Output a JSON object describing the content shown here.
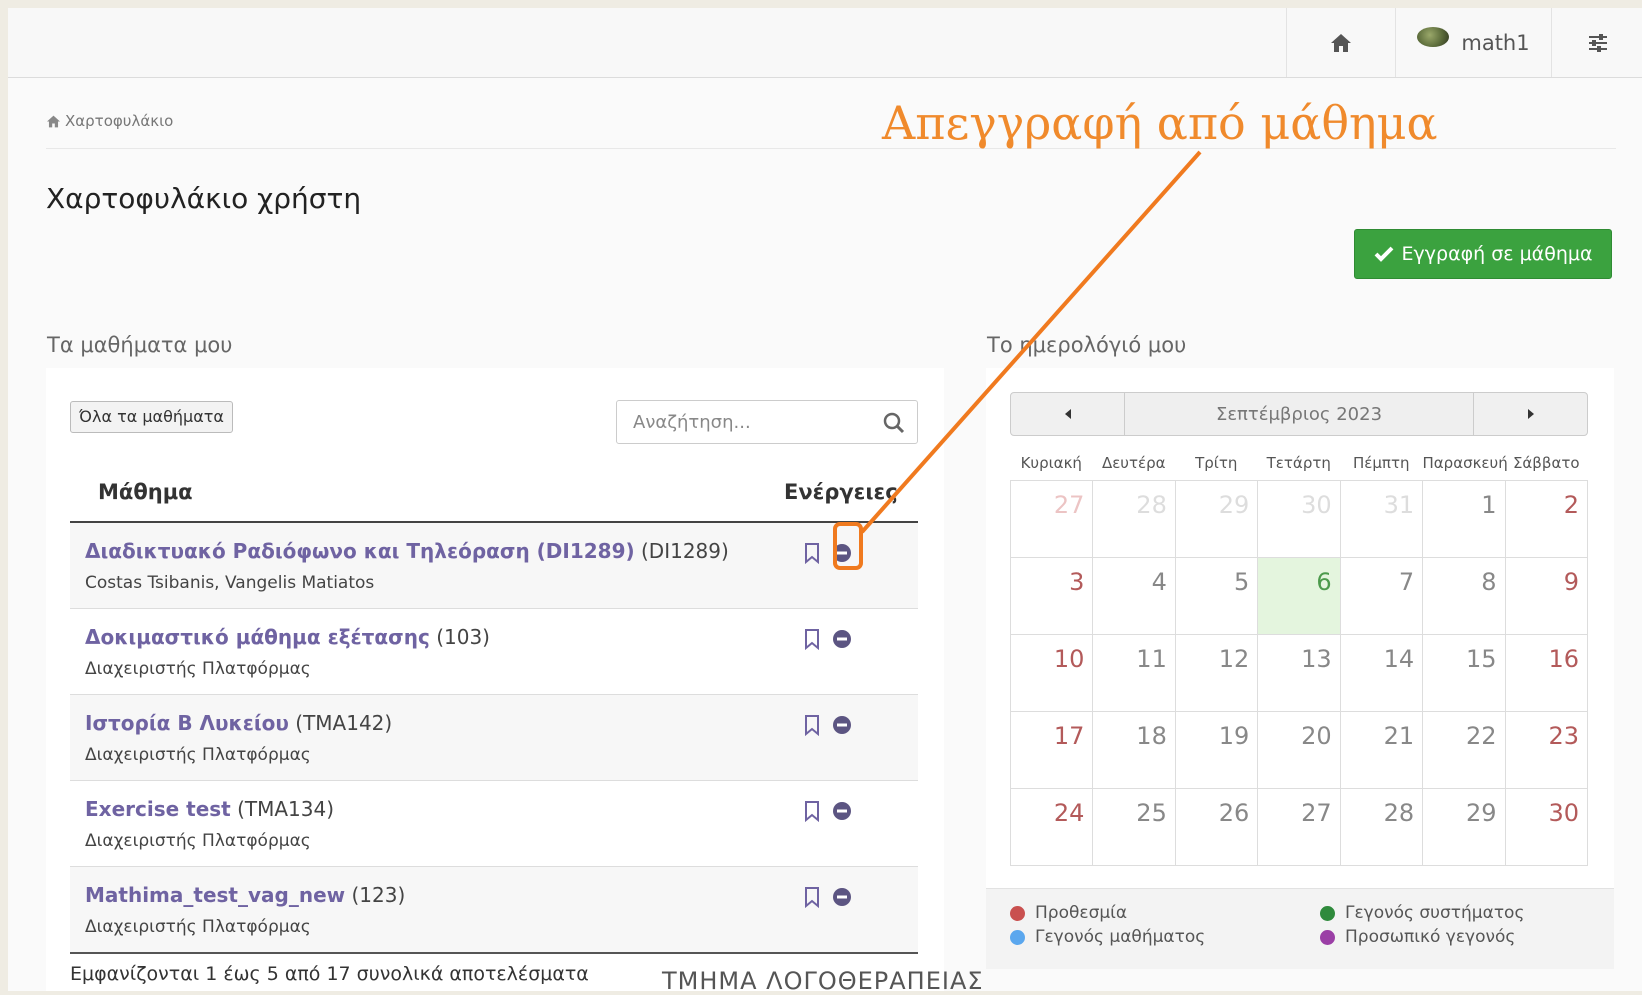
{
  "navbar": {
    "username": "math1",
    "home_icon": "home-icon",
    "settings_icon": "sliders-icon"
  },
  "breadcrumb": {
    "label": "Χαρτοφυλάκιο"
  },
  "page": {
    "title": "Χαρτοφυλάκιο χρήστη",
    "register_button": "Εγγραφή σε μάθημα"
  },
  "courses": {
    "heading": "Τα μαθήματα μου",
    "all_courses_button": "Όλα τα μαθήματα",
    "search_placeholder": "Αναζήτηση...",
    "col_course": "Μάθημα",
    "col_actions": "Ενέργειες",
    "rows": [
      {
        "title": "Διαδικτυακό Ραδιόφωνο και Τηλεόραση (DI1289)",
        "code": "(DI1289)",
        "instructors": "Costas Tsibanis, Vangelis Matiatos"
      },
      {
        "title": "Δοκιμαστικό μάθημα εξέτασης",
        "code": "(103)",
        "instructors": "Διαχειριστής Πλατφόρμας"
      },
      {
        "title": "Ιστορία Β Λυκείου",
        "code": "(TMA142)",
        "instructors": "Διαχειριστής Πλατφόρμας"
      },
      {
        "title": "Exercise test",
        "code": "(TMA134)",
        "instructors": "Διαχειριστής Πλατφόρμας"
      },
      {
        "title": "Mathima_test_vag_new",
        "code": "(123)",
        "instructors": "Διαχειριστής Πλατφόρμας"
      }
    ],
    "results_text": "Εμφανίζονται 1 έως 5 από 17 συνολικά αποτελέσματα"
  },
  "calendar": {
    "heading": "Το ημερολόγιό μου",
    "month": "Σεπτέμβριος 2023",
    "weekdays": [
      "Κυριακή",
      "Δευτέρα",
      "Τρίτη",
      "Τετάρτη",
      "Πέμπτη",
      "Παρασκευή",
      "Σάββατο"
    ],
    "weeks": [
      [
        "27",
        "28",
        "29",
        "30",
        "31",
        "1",
        "2"
      ],
      [
        "3",
        "4",
        "5",
        "6",
        "7",
        "8",
        "9"
      ],
      [
        "10",
        "11",
        "12",
        "13",
        "14",
        "15",
        "16"
      ],
      [
        "17",
        "18",
        "19",
        "20",
        "21",
        "22",
        "23"
      ],
      [
        "24",
        "25",
        "26",
        "27",
        "28",
        "29",
        "30"
      ]
    ],
    "other_month_count_leading": 5,
    "today": "6",
    "legend": [
      {
        "label": "Προθεσμία",
        "color": "#c9504f"
      },
      {
        "label": "Γεγονός μαθήματος",
        "color": "#5ba7ee"
      },
      {
        "label": "Γεγονός συστήματος",
        "color": "#2f8a3c"
      },
      {
        "label": "Προσωπικό γεγονός",
        "color": "#9b3fa6"
      }
    ]
  },
  "annotation": {
    "text": "Απεγγραφή από μάθημα",
    "color": "#f08a2c"
  },
  "footer_text": "ΤΜΗΜΑ ΛΟΓΟΘΕΡΑΠΕΙΑΣ",
  "colors": {
    "accent_green": "#3ba23f",
    "course_link": "#6f63a2",
    "weekend": "#b35a5a",
    "today_bg": "#e4f5de"
  }
}
